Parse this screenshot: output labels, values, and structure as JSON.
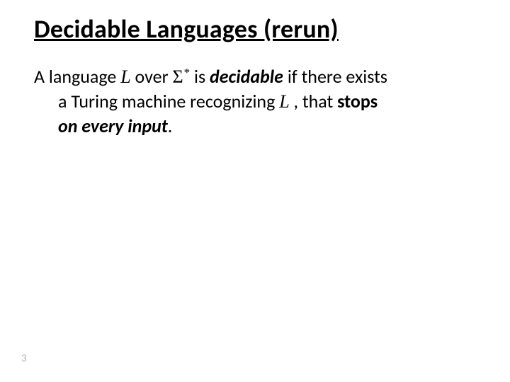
{
  "title": "Decidable Languages (rerun)",
  "body": {
    "p1_a": "A language ",
    "L": "L",
    "p1_b": " over ",
    "sigma": "Σ",
    "star": "*",
    "p1_c": " is ",
    "decidable": "decidable",
    "p1_d": " if there exists",
    "p2_a": "a Turing machine recognizing ",
    "p2_b": " , that ",
    "stops": "stops",
    "p3_a": "on every input",
    "p3_b": "."
  },
  "page": "3"
}
